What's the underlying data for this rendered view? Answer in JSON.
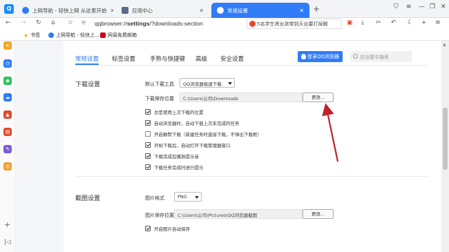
{
  "tabs": [
    {
      "title": "上网导航 - 轻快上网 从这里开始",
      "icon_color": "#2f7cf6"
    },
    {
      "title": "应用中心",
      "icon_color": "#5b6b8c"
    },
    {
      "title": "常规设置",
      "icon_color": "#ffffff",
      "active": true
    }
  ],
  "window": {
    "logo": "Q"
  },
  "nav": {
    "url_prefix": "qqbrowser://",
    "url_bold": "settings",
    "url_suffix": "/?downloads-section",
    "search_text": "5名学生将女孩带到天台要打掉踢"
  },
  "bookmarks": [
    {
      "label": "书签",
      "icon": "star-icon",
      "color": "#f5a623"
    },
    {
      "label": "上网导航 - 轻快上...",
      "icon": "nav-icon",
      "color": "#2f7cf6"
    },
    {
      "label": "网易免费邮箱",
      "icon": "mail-icon",
      "color": "#d0021b"
    }
  ],
  "rail_colors": [
    "#f5a623",
    "#2f7cf6",
    "#2fbf5a",
    "#2f7cf6",
    "#e04a2f",
    "#e04a2f",
    "#7b5cd6",
    "#f0a030"
  ],
  "settings_tabs": [
    "常规设置",
    "标签设置",
    "手势与快捷键",
    "高级",
    "安全设置"
  ],
  "login_label": "登录QQ浏览器",
  "search_placeholder": "在设置中搜索",
  "download": {
    "title": "下载设置",
    "tool_label": "默认下载工具",
    "tool_value": "QQ浏览器极速下载",
    "path_label": "下载保存位置",
    "path_value": "C:\\Users\\公司\\Downloads",
    "change_label": "更改...",
    "options": [
      {
        "label": "总是使用上次下载的位置",
        "checked": true
      },
      {
        "label": "启动浏览器时，自动下载上次未完成的任务",
        "checked": true
      },
      {
        "label": "开启静默下载（新建任务时直接下载，不弹出下载框）",
        "checked": false
      },
      {
        "label": "开始下载后，自动打开下载管理器窗口",
        "checked": true
      },
      {
        "label": "下载完成后播放提示音",
        "checked": true
      },
      {
        "label": "下载任务完成时进行提示",
        "checked": true
      }
    ]
  },
  "screenshot": {
    "title": "截图设置",
    "format_label": "图片格式",
    "format_value": "PNG",
    "path_label": "图片保存位置",
    "path_value": "C:\\Users\\公司\\Pictures\\QQ浏览器截图",
    "change_label": "更改...",
    "auto_save_label": "开启图片自动保存",
    "auto_save_checked": true
  },
  "annotation_color": "#c0202a"
}
